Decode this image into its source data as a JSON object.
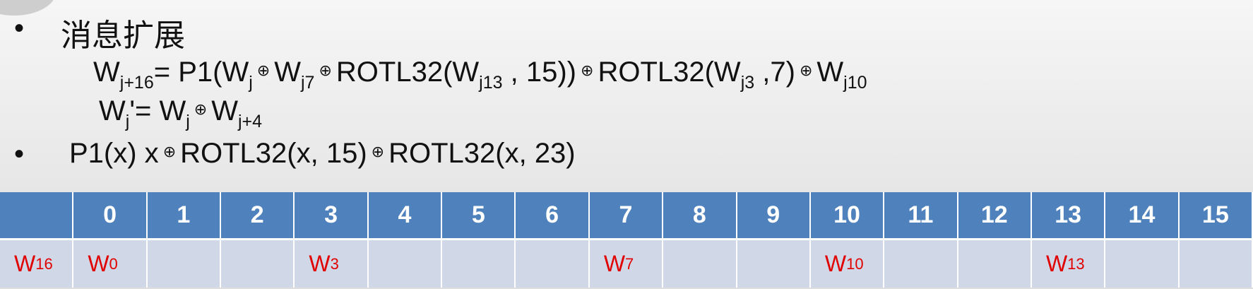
{
  "title": "消息扩展",
  "bullet_symbol": "•",
  "xor_symbol": "⊕",
  "formula1": {
    "lhs": "W",
    "lhs_sub": "j+16",
    "t1": "= P1(W",
    "s1": "j",
    "t2": "W",
    "s2": "j7",
    "t3": "ROTL32(W",
    "s3": "j13",
    "t4": " , 15))",
    "t5": "ROTL32(W",
    "s5": "j3",
    "t6": " ,7)",
    "t7": "W",
    "s7": "j10"
  },
  "formula2": {
    "lhs": "W",
    "lhs_sub": "j",
    "t1": "'= W",
    "s1": "j",
    "t2": "W",
    "s2": "j+4"
  },
  "formula3": {
    "t1": "P1(x)  x",
    "t2": "ROTL32(x, 15)",
    "t3": "ROTL32(x, 23)"
  },
  "table": {
    "header_cells": [
      "",
      "0",
      "1",
      "2",
      "3",
      "4",
      "5",
      "6",
      "7",
      "8",
      "9",
      "10",
      "11",
      "12",
      "13",
      "14",
      "15"
    ],
    "data_cells": [
      {
        "base": "W",
        "sub": "16"
      },
      {
        "base": "W",
        "sub": "0"
      },
      {
        "base": "",
        "sub": ""
      },
      {
        "base": "",
        "sub": ""
      },
      {
        "base": "W",
        "sub": "3"
      },
      {
        "base": "",
        "sub": ""
      },
      {
        "base": "",
        "sub": ""
      },
      {
        "base": "",
        "sub": ""
      },
      {
        "base": "W",
        "sub": "7"
      },
      {
        "base": "",
        "sub": ""
      },
      {
        "base": "",
        "sub": ""
      },
      {
        "base": "W",
        "sub": "10"
      },
      {
        "base": "",
        "sub": ""
      },
      {
        "base": "",
        "sub": ""
      },
      {
        "base": "W",
        "sub": "13"
      },
      {
        "base": "",
        "sub": ""
      },
      {
        "base": "",
        "sub": ""
      }
    ],
    "header_color": "#4f81bd",
    "data_color": "#d0d8e8",
    "highlight_text_color": "#e00000"
  }
}
